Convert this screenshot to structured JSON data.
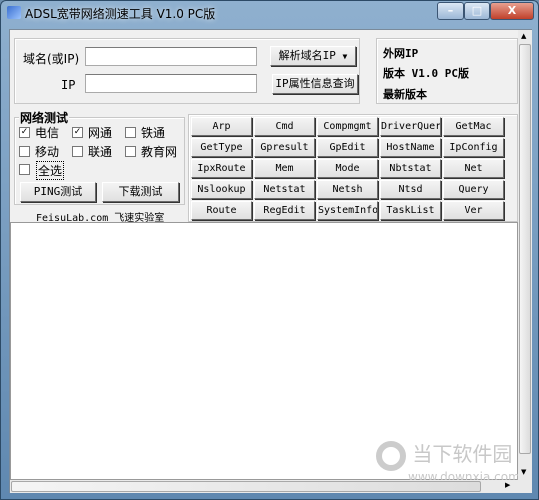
{
  "window": {
    "title": "ADSL宽带网络测速工具 V1.0 PC版",
    "minimize": "–",
    "maximize": "□",
    "close": "X"
  },
  "query": {
    "domain_label": "域名(或IP)",
    "domain_value": "",
    "ip_label": "IP",
    "ip_value": "",
    "resolve_button": "解析域名IP",
    "resolve_arrow": "▼",
    "ipinfo_button": "IP属性信息查询"
  },
  "info": {
    "external_ip": "外网IP",
    "version": "版本 V1.0 PC版",
    "latest": "最新版本"
  },
  "network_test": {
    "title": "网络测试",
    "options": [
      {
        "label": "电信",
        "checked": true
      },
      {
        "label": "网通",
        "checked": true
      },
      {
        "label": "铁通",
        "checked": false
      },
      {
        "label": "移动",
        "checked": false
      },
      {
        "label": "联通",
        "checked": false
      },
      {
        "label": "教育网",
        "checked": false
      }
    ],
    "select_all": {
      "label": "全选",
      "checked": false
    },
    "ping_button": "PING测试",
    "download_button": "下载测试"
  },
  "footer_credit": "FeisuLab.com 飞速实验室",
  "commands": [
    [
      "Arp",
      "Cmd",
      "Compmgmt",
      "DriverQuery",
      "GetMac"
    ],
    [
      "GetType",
      "Gpresult",
      "GpEdit",
      "HostName",
      "IpConfig"
    ],
    [
      "IpxRoute",
      "Mem",
      "Mode",
      "Nbtstat",
      "Net"
    ],
    [
      "Nslookup",
      "Netstat",
      "Netsh",
      "Ntsd",
      "Query"
    ],
    [
      "Route",
      "RegEdit",
      "SystemInfo",
      "TaskList",
      "Ver"
    ]
  ],
  "output": "",
  "watermark": {
    "name": "当下软件园",
    "url": "www.downxia.com"
  }
}
